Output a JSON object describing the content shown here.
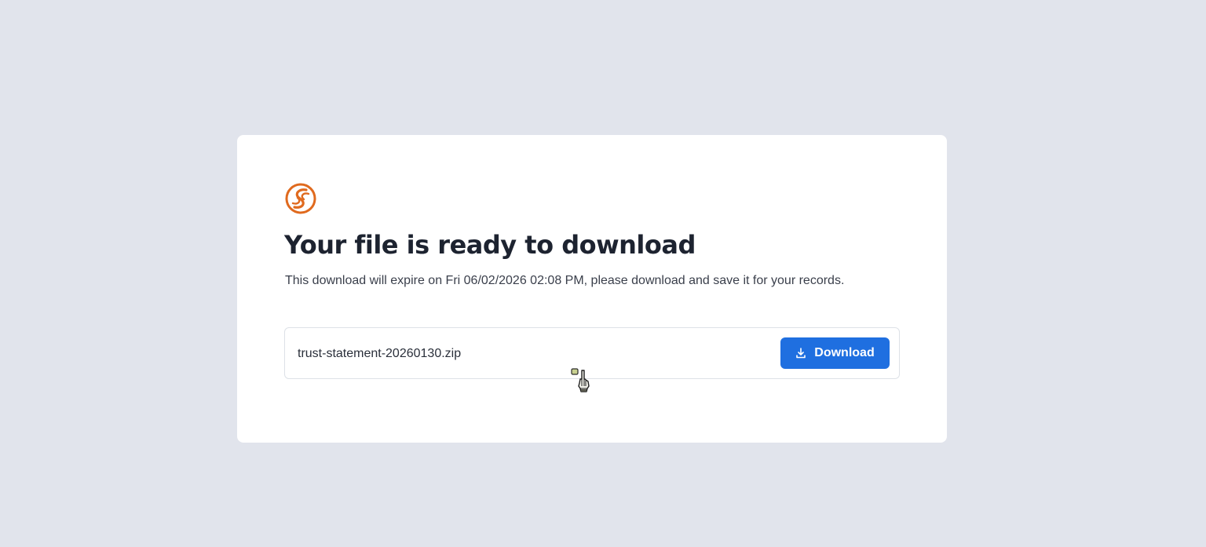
{
  "page": {
    "title": "Your file is ready to download",
    "subtitle": "This download will expire on Fri 06/02/2026 02:08 PM, please download and save it for your records."
  },
  "file": {
    "name": "trust-statement-20260130.zip"
  },
  "actions": {
    "download_label": "Download"
  },
  "icons": {
    "logo": "brand-logo-icon",
    "download": "download-icon",
    "cursor": "pointer-cursor-icon"
  },
  "colors": {
    "background": "#e1e4ec",
    "card": "#ffffff",
    "brand_orange": "#e06a1e",
    "accent_blue": "#1f6fe0",
    "title_text": "#1d2330"
  }
}
